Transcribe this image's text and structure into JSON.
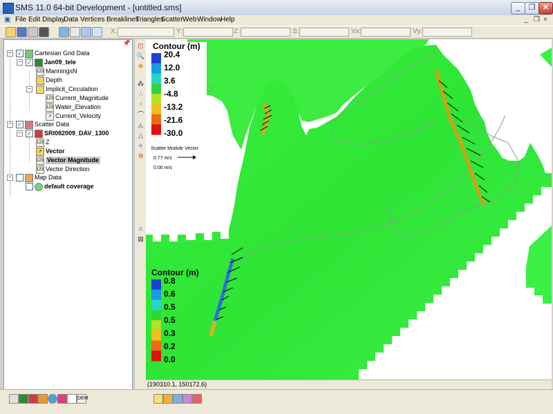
{
  "window": {
    "title": "SMS 11.0 64-bit Development - [untitled.sms]",
    "controls": {
      "minimize": "_",
      "restore": "❐",
      "close": "✕"
    },
    "mdi_controls": {
      "minimize": "_",
      "restore": "❐",
      "close": "×"
    }
  },
  "menu": [
    "File",
    "Edit",
    "Display",
    "Data",
    "Vertices",
    "Breaklines",
    "Triangles",
    "Scatter",
    "Web",
    "Window",
    "Help"
  ],
  "coords": {
    "x": "X:",
    "y": "Y:",
    "z": "Z:",
    "s": "S:",
    "vx": "Vx:",
    "vy": "Vy:"
  },
  "tree": {
    "cartesian": "Cartesian Grid Data",
    "grid": "Jan09_tele",
    "mannings": "ManningsN",
    "depth": "Depth",
    "implicit": "Implicit_Circulation",
    "cur_mag": "Current_Magnitude",
    "water": "Water_Elevation",
    "cur_vel": "Current_Velocity",
    "scatter": "Scatter Data",
    "scatter_set": "SRI082009_DAV_1300",
    "z": "Z",
    "vector": "Vector",
    "vmag": "Vector Magnitude",
    "vdir": "Vector Direction",
    "map": "Map Data",
    "coverage": "default coverage"
  },
  "legend_top": {
    "title": "Contour (m)",
    "values": [
      "20.4",
      "12.0",
      "3.6",
      "-4.8",
      "-13.2",
      "-21.6",
      "-30.0"
    ],
    "colors": [
      "#1c3fd1",
      "#1a9be0",
      "#26d6c9",
      "#2ed63a",
      "#b2e028",
      "#f2bd1d",
      "#ee6b12",
      "#e01212"
    ]
  },
  "vector_legend": {
    "title": "Scatter Module Vector",
    "max": "0.77 m/s",
    "min": "0.00 m/s"
  },
  "legend_bottom": {
    "title": "Contour (m)",
    "values": [
      "0.8",
      "0.6",
      "0.5",
      "0.5",
      "0.3",
      "0.2",
      "0.0"
    ],
    "colors": [
      "#1c3fd1",
      "#1a9be0",
      "#26d6c9",
      "#2ed63a",
      "#b2e028",
      "#f2bd1d",
      "#ee6b12",
      "#e01212"
    ]
  },
  "status": {
    "cursor": "(190310.1, 150172.6)"
  }
}
